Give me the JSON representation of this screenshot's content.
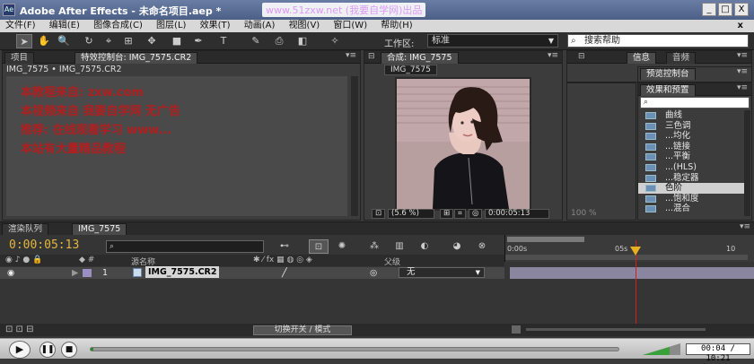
{
  "titlebar": {
    "title": "Adobe After Effects - 未命名项目.aep *",
    "watermark": "www.51zxw.net (我要自学网)出品",
    "app_icon": "Ae",
    "minimize": "_",
    "maximize": "□",
    "close": "X"
  },
  "menu": {
    "items": [
      "文件(F)",
      "编辑(E)",
      "图像合成(C)",
      "图层(L)",
      "效果(T)",
      "动画(A)",
      "视图(V)",
      "窗口(W)",
      "帮助(H)"
    ],
    "close_mark": "x"
  },
  "toolbar": {
    "workspace_label": "工作区:",
    "workspace_value": "标准",
    "help_search": "搜索帮助"
  },
  "project_panel": {
    "tab_project": "项目",
    "tab_effect_controls": "特效控制台: IMG_7575.CR2",
    "path": "IMG_7575 • IMG_7575.CR2",
    "notes": [
      "本教程来自: zxw.com",
      "本视频来自 我要自学网 无广告",
      "推荐: 在线观看学习 www...",
      "本站有大量精品教程"
    ]
  },
  "comp_panel": {
    "tab_label": "合成: IMG_7575",
    "comp_name": "IMG_7575",
    "zoom": "(5.6 %)",
    "timecode": "0:00:05:13"
  },
  "right_panels": {
    "info_tab": "信息",
    "audio_tab": "音频",
    "preview_tab": "预览控制台",
    "effects_tab": "效果和预置",
    "side_zoom": "100 %",
    "effects": [
      {
        "label": "曲线"
      },
      {
        "label": "三色调"
      },
      {
        "label": "...均化"
      },
      {
        "label": "...链接"
      },
      {
        "label": "...平衡"
      },
      {
        "label": "...(HLS)"
      },
      {
        "label": "...稳定器"
      },
      {
        "label": "色阶",
        "selected": true
      },
      {
        "label": "...饱和度"
      },
      {
        "label": "...混合"
      },
      {
        "label": "...曲线"
      }
    ]
  },
  "timeline": {
    "tab_render": "渲染队列",
    "tab_comp": "IMG_7575",
    "timecode": "0:00:05:13",
    "ruler_start": "0:00s",
    "ruler_mid": "05s",
    "ruler_end": "10",
    "col_source": "源名称",
    "col_parent": "父级",
    "layer": {
      "index": "1",
      "name": "IMG_7575.CR2",
      "parent": "无"
    },
    "switch_modes": "切换开关 / 模式"
  },
  "player": {
    "time": "00:04 / 10:21",
    "progress_fraction": 0.005
  }
}
